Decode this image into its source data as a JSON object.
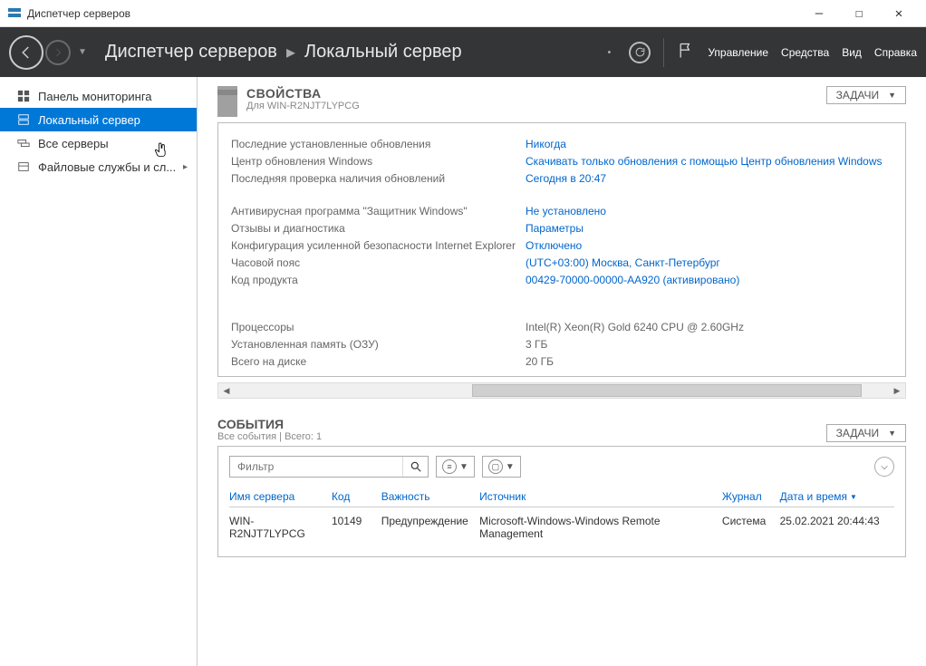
{
  "titlebar": {
    "title": "Диспетчер серверов"
  },
  "breadcrumb": {
    "root": "Диспетчер серверов",
    "page": "Локальный сервер"
  },
  "menu": {
    "manage": "Управление",
    "tools": "Средства",
    "view": "Вид",
    "help": "Справка"
  },
  "sidebar": {
    "dashboard": "Панель мониторинга",
    "local_server": "Локальный сервер",
    "all_servers": "Все серверы",
    "file_services": "Файловые службы и сл..."
  },
  "properties": {
    "title": "СВОЙСТВА",
    "subtitle": "Для WIN-R2NJT7LYPCG",
    "tasks_label": "ЗАДАЧИ",
    "rows": {
      "last_updates_label": "Последние установленные обновления",
      "last_updates_value": "Никогда",
      "wu_label": "Центр обновления Windows",
      "wu_value": "Скачивать только обновления с помощью Центр обновления Windows",
      "last_check_label": "Последняя проверка наличия обновлений",
      "last_check_value": "Сегодня в 20:47",
      "av_label": "Антивирусная программа \"Защитник Windows\"",
      "av_value": "Не установлено",
      "feedback_label": "Отзывы и диагностика",
      "feedback_value": "Параметры",
      "ie_esc_label": "Конфигурация усиленной безопасности Internet Explorer",
      "ie_esc_value": "Отключено",
      "tz_label": "Часовой пояс",
      "tz_value": "(UTC+03:00) Москва, Санкт-Петербург",
      "product_label": "Код продукта",
      "product_value": "00429-70000-00000-AA920 (активировано)",
      "cpu_label": "Процессоры",
      "cpu_value": "Intel(R) Xeon(R) Gold 6240 CPU @ 2.60GHz",
      "ram_label": "Установленная память (ОЗУ)",
      "ram_value": "3 ГБ",
      "disk_label": "Всего на диске",
      "disk_value": "20 ГБ"
    }
  },
  "events": {
    "title": "СОБЫТИЯ",
    "subtitle": "Все события | Всего: 1",
    "tasks_label": "ЗАДАЧИ",
    "filter_placeholder": "Фильтр",
    "columns": {
      "server": "Имя сервера",
      "code": "Код",
      "severity": "Важность",
      "source": "Источник",
      "log": "Журнал",
      "datetime": "Дата и время"
    },
    "row": {
      "server": "WIN-R2NJT7LYPCG",
      "code": "10149",
      "severity": "Предупреждение",
      "source": "Microsoft-Windows-Windows Remote Management",
      "log": "Система",
      "datetime": "25.02.2021 20:44:43"
    }
  }
}
